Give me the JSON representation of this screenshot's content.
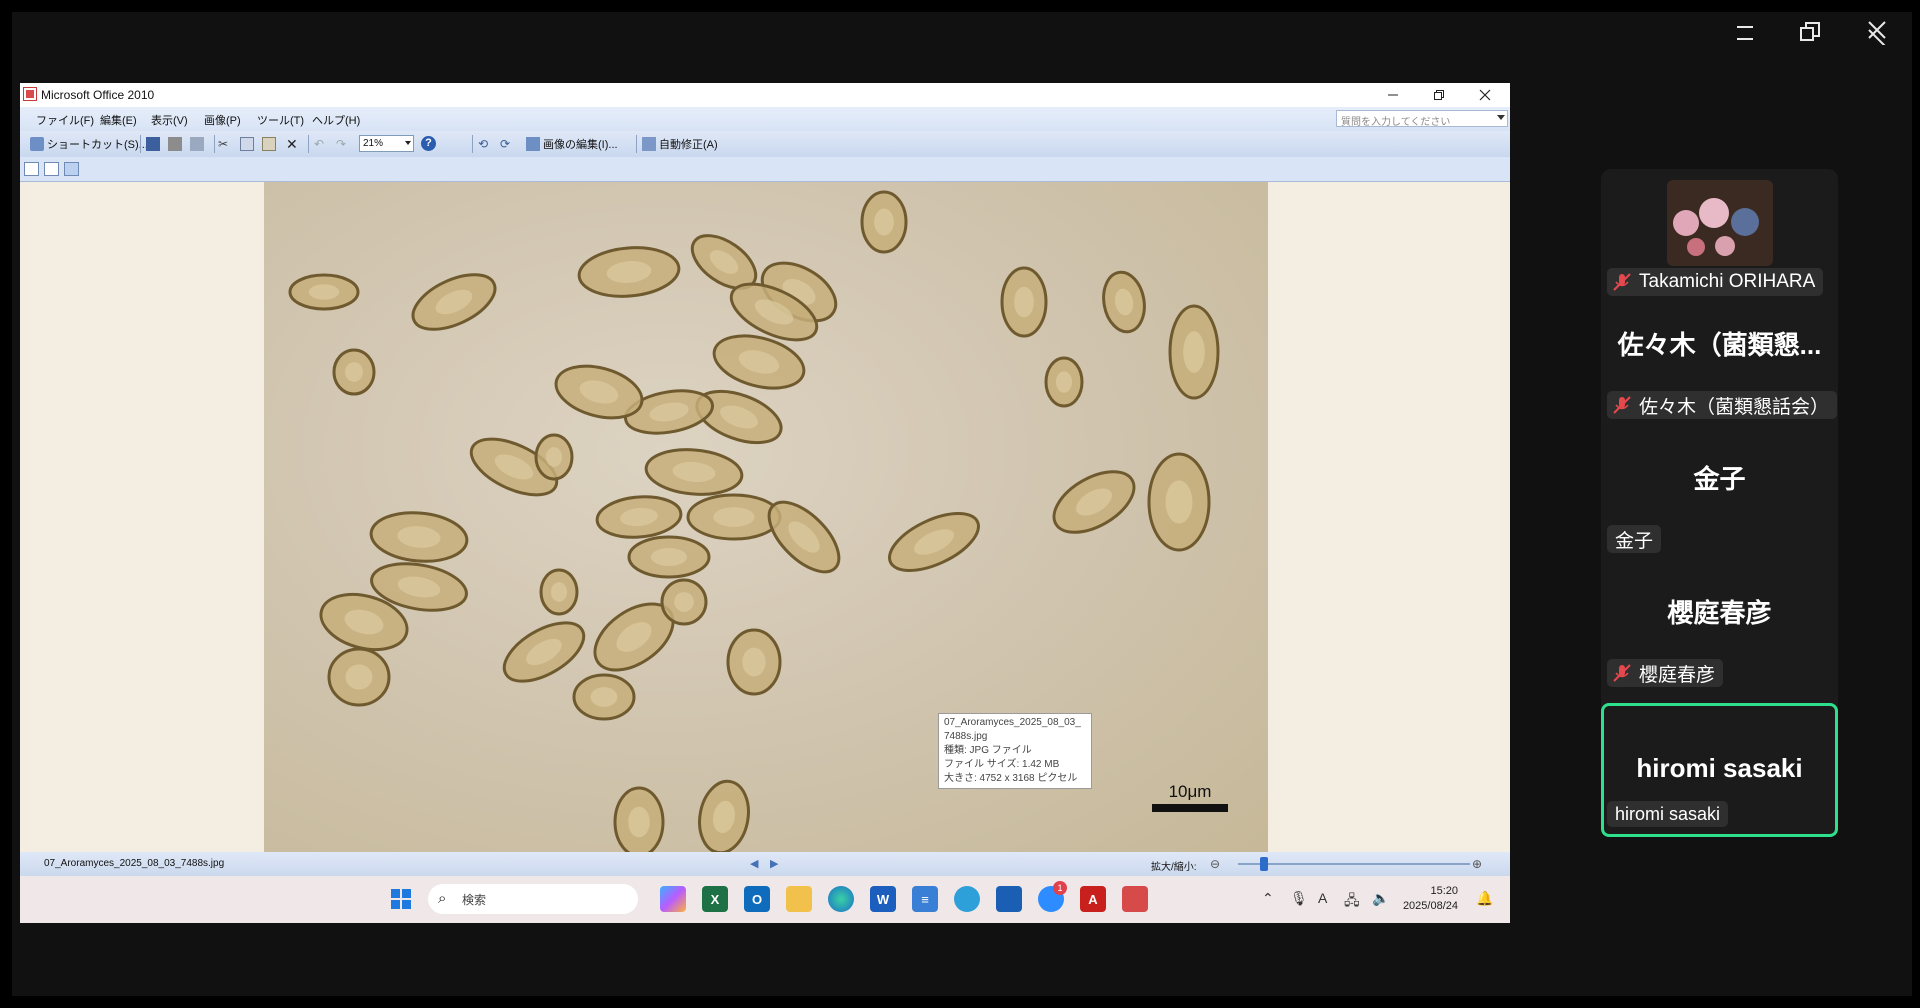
{
  "meeting_controls": {
    "minimize_icon": "minimize-icon",
    "restore_icon": "restore-icon",
    "close_icon": "close-icon"
  },
  "app": {
    "title": "Microsoft Office 2010",
    "menu": [
      "ファイル(F)",
      "編集(E)",
      "表示(V)",
      "画像(P)",
      "ツール(T)",
      "ヘルプ(H)"
    ],
    "ask_placeholder": "質問を入力してください",
    "toolbar": {
      "shortcut_label": "ショートカット(S)...",
      "zoom": "21%",
      "edit_picture_label": "画像の編集(I)...",
      "auto_correct_label": "自動修正(A)"
    },
    "image": {
      "scale_label": "10μm",
      "tooltip": [
        "07_Aroramyces_2025_08_03_",
        "7488s.jpg",
        "種類: JPG ファイル",
        "ファイル サイズ: 1.42 MB",
        "大きさ: 4752 x 3168 ピクセル"
      ]
    },
    "status": {
      "filename": "07_Aroramyces_2025_08_03_7488s.jpg",
      "zoom_label": "拡大/縮小:",
      "zoom_fraction": 0.11
    }
  },
  "taskbar": {
    "search_placeholder": "検索",
    "time": "15:20",
    "date": "2025/08/24",
    "badge_count": "1",
    "colors": {
      "start": "#1f7ae0",
      "excel": "#1e7145",
      "outlook": "#0f6cbd",
      "word": "#1b5ebe",
      "acrobat": "#c8201d",
      "accent_badge": "#e0414b"
    }
  },
  "participants": [
    {
      "tile_name": "",
      "tag": "Takamichi ORIHARA",
      "muted": true,
      "has_video_avatar": true
    },
    {
      "tile_name": "佐々木（菌類懇...",
      "tag": "佐々木（菌類懇話会）",
      "muted": true
    },
    {
      "tile_name": "金子",
      "tag": "金子",
      "muted": false
    },
    {
      "tile_name": "櫻庭春彦",
      "tag": "櫻庭春彦",
      "muted": true
    },
    {
      "tile_name": "hiromi sasaki",
      "tag": "hiromi sasaki",
      "muted": false,
      "active_speaker": true
    }
  ],
  "colors": {
    "active_speaker_border": "#2ee08b",
    "muted_icon": "#e5484d"
  }
}
